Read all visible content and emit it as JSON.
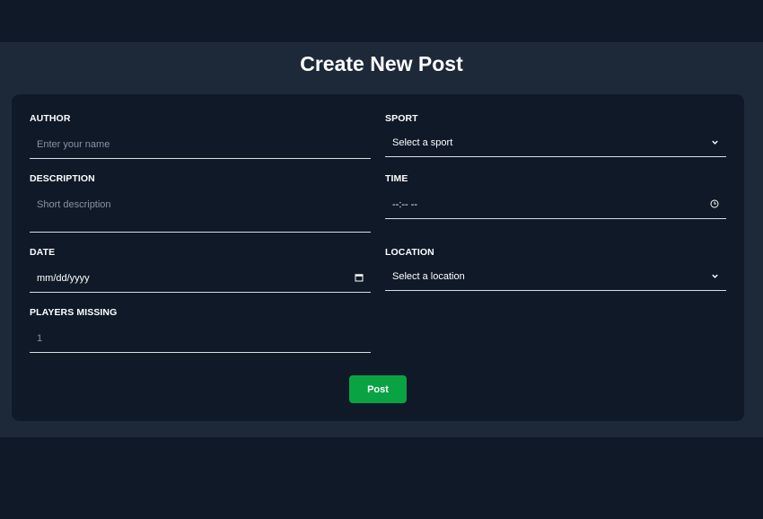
{
  "page_title": "Create New Post",
  "form": {
    "author": {
      "label": "AUTHOR",
      "placeholder": "Enter your name"
    },
    "sport": {
      "label": "SPORT",
      "selected": "Select a sport"
    },
    "description": {
      "label": "DESCRIPTION",
      "placeholder": "Short description"
    },
    "time": {
      "label": "TIME",
      "value": "--:-- --"
    },
    "date": {
      "label": "DATE",
      "value": "mm/dd/yyyy"
    },
    "location": {
      "label": "LOCATION",
      "selected": "Select a location"
    },
    "players_missing": {
      "label": "PLAYERS MISSING",
      "placeholder": "1"
    },
    "submit_label": "Post"
  },
  "icons": {
    "dropdown": "chevron-down-icon",
    "clock": "clock-icon",
    "calendar": "calendar-icon"
  },
  "colors": {
    "page_bg": "#0f1928",
    "band_bg": "#1d2939",
    "card_bg": "#0f1928",
    "button": "#0aa344"
  }
}
